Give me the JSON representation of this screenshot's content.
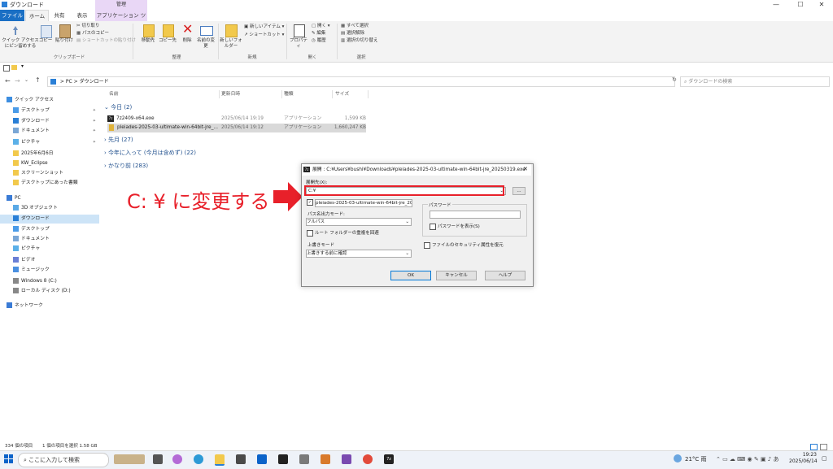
{
  "window": {
    "title": "ダウンロード",
    "minimize": "—",
    "maximize": "☐",
    "close": "✕"
  },
  "ribbon_tabs": {
    "file": "ファイル",
    "home": "ホーム",
    "share": "共有",
    "view": "表示",
    "manage": "管理",
    "app_tools": "アプリケーション ツール"
  },
  "ribbon": {
    "clipboard": {
      "pin": "クイック アクセスにピン留めする",
      "copy": "コピー",
      "paste": "貼り付け",
      "cut": "切り取り",
      "copy_path": "パスのコピー",
      "paste_shortcut": "ショートカットの貼り付け",
      "label": "クリップボード"
    },
    "organize": {
      "move": "移動先",
      "copy_to": "コピー先",
      "delete": "削除",
      "rename": "名前の変更",
      "label": "整理"
    },
    "new": {
      "new_folder": "新しいフォルダー",
      "new_item": "新しいアイテム ▾",
      "shortcut": "ショートカット ▾",
      "label": "新規"
    },
    "open": {
      "properties": "プロパティ",
      "open": "開く ▾",
      "edit": "編集",
      "history": "履歴",
      "label": "開く"
    },
    "select": {
      "select_all": "すべて選択",
      "select_none": "選択解除",
      "invert": "選択の切り替え",
      "label": "選択"
    }
  },
  "address": {
    "path_pc": "PC",
    "path_sep": ">",
    "path_folder": "ダウンロード",
    "search_placeholder": "ダウンロードの検索"
  },
  "nav": [
    {
      "label": "クイック アクセス",
      "color": "#3d8ee0",
      "pinned": false,
      "indent": 0
    },
    {
      "label": "デスクトップ",
      "color": "#4a9be8",
      "pinned": true,
      "indent": 1
    },
    {
      "label": "ダウンロード",
      "color": "#2a7fd6",
      "pinned": true,
      "indent": 1
    },
    {
      "label": "ドキュメント",
      "color": "#7aa7d6",
      "pinned": true,
      "indent": 1
    },
    {
      "label": "ピクチャ",
      "color": "#5bb0e8",
      "pinned": true,
      "indent": 1
    },
    {
      "label": "2025年6月6日",
      "color": "#f2c94c",
      "pinned": false,
      "indent": 1
    },
    {
      "label": "KW_Eclipse",
      "color": "#f2c94c",
      "pinned": false,
      "indent": 1
    },
    {
      "label": "スクリーンショット",
      "color": "#f2c94c",
      "pinned": false,
      "indent": 1
    },
    {
      "label": "デスクトップにあった書類",
      "color": "#f2c94c",
      "pinned": false,
      "indent": 1
    },
    {
      "label": "PC",
      "color": "#3a7bd5",
      "pinned": false,
      "indent": 0
    },
    {
      "label": "3D オブジェクト",
      "color": "#5aa9e6",
      "pinned": false,
      "indent": 1
    },
    {
      "label": "ダウンロード",
      "color": "#2a7fd6",
      "pinned": false,
      "indent": 1,
      "selected": true
    },
    {
      "label": "デスクトップ",
      "color": "#4a9be8",
      "pinned": false,
      "indent": 1
    },
    {
      "label": "ドキュメント",
      "color": "#7aa7d6",
      "pinned": false,
      "indent": 1
    },
    {
      "label": "ピクチャ",
      "color": "#5bb0e8",
      "pinned": false,
      "indent": 1
    },
    {
      "label": "ビデオ",
      "color": "#6a7fd6",
      "pinned": false,
      "indent": 1
    },
    {
      "label": "ミュージック",
      "color": "#4a8fe0",
      "pinned": false,
      "indent": 1
    },
    {
      "label": "Windows 8 (C:)",
      "color": "#888888",
      "pinned": false,
      "indent": 1
    },
    {
      "label": "ローカル ディスク (D:)",
      "color": "#888888",
      "pinned": false,
      "indent": 1
    },
    {
      "label": "ネットワーク",
      "color": "#3a7bd5",
      "pinned": false,
      "indent": 0
    }
  ],
  "columns": {
    "name": "名前",
    "date": "更新日時",
    "type": "種類",
    "size": "サイズ"
  },
  "groups": {
    "today": "今日 (2)",
    "last_month": "先月 (27)",
    "earlier_year": "今年に入って (今月は含めず) (22)",
    "long_ago": "かなり前 (283)"
  },
  "files": [
    {
      "name": "7z2409-x64.exe",
      "date": "2025/06/14 19:19",
      "type": "アプリケーション",
      "size": "1,599 KB",
      "selected": false
    },
    {
      "name": "pleiades-2025-03-ultimate-win-64bit-jre_...",
      "date": "2025/06/14 19:12",
      "type": "アプリケーション",
      "size": "1,660,247 KB",
      "selected": true
    }
  ],
  "status": {
    "count": "334 個の項目",
    "selected": "1 個の項目を選択  1.58 GB"
  },
  "dialog": {
    "title": "展開 : C:¥Users¥bushi¥Downloads¥pleiades-2025-03-ultimate-win-64bit-jre_20250319.exe",
    "dest_label": "展開先(X):",
    "dest_value": "C:¥",
    "folder_value": "pleiades-2025-03-ultimate-win-64bit-jre_20",
    "path_mode_label": "パス名出力モード:",
    "path_mode_value": "フルパス",
    "root_folder": "ルート フォルダーの重複を回避",
    "overwrite_label": "上書きモード",
    "overwrite_value": "上書きする前に確認",
    "password_label": "パスワード",
    "show_password": "パスワードを表示(S)",
    "restore_security": "ファイルのセキュリティ属性を復元",
    "ok": "OK",
    "cancel": "キャンセル",
    "help": "ヘルプ",
    "browse": "..."
  },
  "annotation": {
    "text": "C: ¥ に変更する",
    "color": "#e8202a"
  },
  "taskbar": {
    "search": "ここに入力して検索",
    "weather": "21°C 雨",
    "time": "19:23",
    "date": "2025/06/14"
  }
}
